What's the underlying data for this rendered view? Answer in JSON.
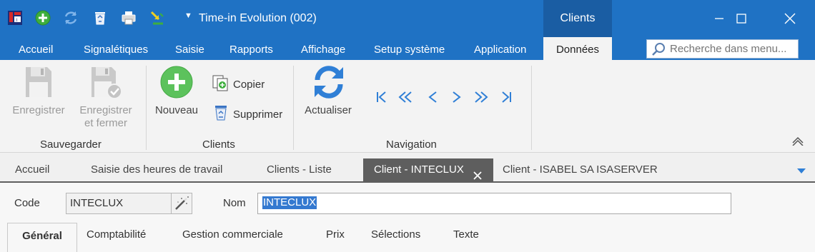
{
  "titlebar": {
    "title": "Time-in Evolution (002)",
    "context_tab": "Clients",
    "quick_access_icons": [
      "app-logo-icon",
      "add-icon",
      "refresh-icon",
      "recycle-bin-icon",
      "print-icon",
      "import-export-icon"
    ]
  },
  "ribbon_tabs": [
    "Accueil",
    "Signalétiques",
    "Saisie",
    "Rapports",
    "Affichage",
    "Setup système",
    "Application",
    "Données"
  ],
  "active_ribbon_tab": "Données",
  "search": {
    "placeholder": "Recherche dans menu..."
  },
  "ribbon": {
    "sauvegarder": {
      "label": "Sauvegarder",
      "enregistrer": "Enregistrer",
      "enregistrer_fermer_1": "Enregistrer",
      "enregistrer_fermer_2": "et fermer"
    },
    "clients": {
      "label": "Clients",
      "nouveau": "Nouveau",
      "copier": "Copier",
      "supprimer": "Supprimer"
    },
    "navigation": {
      "label": "Navigation",
      "actualiser": "Actualiser",
      "buttons": [
        "first-record-icon",
        "previous-page-icon",
        "previous-record-icon",
        "next-record-icon",
        "next-page-icon",
        "last-record-icon"
      ]
    }
  },
  "document_tabs": {
    "accueil": "Accueil",
    "saisie": "Saisie des heures de travail",
    "clients_liste": "Clients - Liste",
    "client_inteclux": "Client - INTECLUX",
    "client_isabel": "Client - ISABEL SA ISASERVER"
  },
  "form": {
    "code_label": "Code",
    "code_value": "INTECLUX",
    "nom_label": "Nom",
    "nom_value": "INTECLUX"
  },
  "sub_tabs": {
    "general": "Général",
    "comptabilite": "Comptabilité",
    "gestion": "Gestion commerciale",
    "prix": "Prix",
    "selections": "Sélections",
    "texte": "Texte"
  },
  "colors": {
    "titlebar": "#1f72c4",
    "context_tab": "#1a5da3",
    "active_doc_tab": "#5e5e5e",
    "selection": "#3479d0"
  }
}
